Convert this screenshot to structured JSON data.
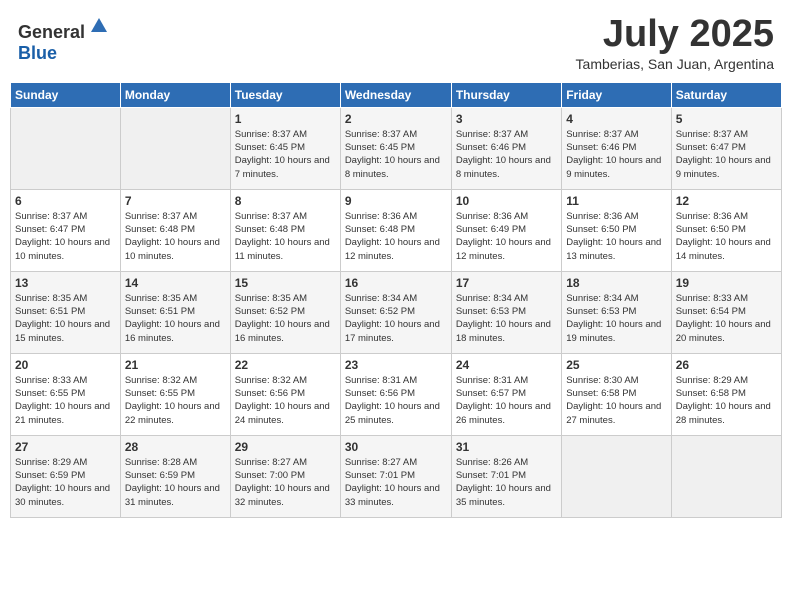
{
  "header": {
    "logo_general": "General",
    "logo_blue": "Blue",
    "month_title": "July 2025",
    "subtitle": "Tamberias, San Juan, Argentina"
  },
  "days_of_week": [
    "Sunday",
    "Monday",
    "Tuesday",
    "Wednesday",
    "Thursday",
    "Friday",
    "Saturday"
  ],
  "weeks": [
    [
      {
        "day": "",
        "sunrise": "",
        "sunset": "",
        "daylight": ""
      },
      {
        "day": "",
        "sunrise": "",
        "sunset": "",
        "daylight": ""
      },
      {
        "day": "1",
        "sunrise": "Sunrise: 8:37 AM",
        "sunset": "Sunset: 6:45 PM",
        "daylight": "Daylight: 10 hours and 7 minutes."
      },
      {
        "day": "2",
        "sunrise": "Sunrise: 8:37 AM",
        "sunset": "Sunset: 6:45 PM",
        "daylight": "Daylight: 10 hours and 8 minutes."
      },
      {
        "day": "3",
        "sunrise": "Sunrise: 8:37 AM",
        "sunset": "Sunset: 6:46 PM",
        "daylight": "Daylight: 10 hours and 8 minutes."
      },
      {
        "day": "4",
        "sunrise": "Sunrise: 8:37 AM",
        "sunset": "Sunset: 6:46 PM",
        "daylight": "Daylight: 10 hours and 9 minutes."
      },
      {
        "day": "5",
        "sunrise": "Sunrise: 8:37 AM",
        "sunset": "Sunset: 6:47 PM",
        "daylight": "Daylight: 10 hours and 9 minutes."
      }
    ],
    [
      {
        "day": "6",
        "sunrise": "Sunrise: 8:37 AM",
        "sunset": "Sunset: 6:47 PM",
        "daylight": "Daylight: 10 hours and 10 minutes."
      },
      {
        "day": "7",
        "sunrise": "Sunrise: 8:37 AM",
        "sunset": "Sunset: 6:48 PM",
        "daylight": "Daylight: 10 hours and 10 minutes."
      },
      {
        "day": "8",
        "sunrise": "Sunrise: 8:37 AM",
        "sunset": "Sunset: 6:48 PM",
        "daylight": "Daylight: 10 hours and 11 minutes."
      },
      {
        "day": "9",
        "sunrise": "Sunrise: 8:36 AM",
        "sunset": "Sunset: 6:48 PM",
        "daylight": "Daylight: 10 hours and 12 minutes."
      },
      {
        "day": "10",
        "sunrise": "Sunrise: 8:36 AM",
        "sunset": "Sunset: 6:49 PM",
        "daylight": "Daylight: 10 hours and 12 minutes."
      },
      {
        "day": "11",
        "sunrise": "Sunrise: 8:36 AM",
        "sunset": "Sunset: 6:50 PM",
        "daylight": "Daylight: 10 hours and 13 minutes."
      },
      {
        "day": "12",
        "sunrise": "Sunrise: 8:36 AM",
        "sunset": "Sunset: 6:50 PM",
        "daylight": "Daylight: 10 hours and 14 minutes."
      }
    ],
    [
      {
        "day": "13",
        "sunrise": "Sunrise: 8:35 AM",
        "sunset": "Sunset: 6:51 PM",
        "daylight": "Daylight: 10 hours and 15 minutes."
      },
      {
        "day": "14",
        "sunrise": "Sunrise: 8:35 AM",
        "sunset": "Sunset: 6:51 PM",
        "daylight": "Daylight: 10 hours and 16 minutes."
      },
      {
        "day": "15",
        "sunrise": "Sunrise: 8:35 AM",
        "sunset": "Sunset: 6:52 PM",
        "daylight": "Daylight: 10 hours and 16 minutes."
      },
      {
        "day": "16",
        "sunrise": "Sunrise: 8:34 AM",
        "sunset": "Sunset: 6:52 PM",
        "daylight": "Daylight: 10 hours and 17 minutes."
      },
      {
        "day": "17",
        "sunrise": "Sunrise: 8:34 AM",
        "sunset": "Sunset: 6:53 PM",
        "daylight": "Daylight: 10 hours and 18 minutes."
      },
      {
        "day": "18",
        "sunrise": "Sunrise: 8:34 AM",
        "sunset": "Sunset: 6:53 PM",
        "daylight": "Daylight: 10 hours and 19 minutes."
      },
      {
        "day": "19",
        "sunrise": "Sunrise: 8:33 AM",
        "sunset": "Sunset: 6:54 PM",
        "daylight": "Daylight: 10 hours and 20 minutes."
      }
    ],
    [
      {
        "day": "20",
        "sunrise": "Sunrise: 8:33 AM",
        "sunset": "Sunset: 6:55 PM",
        "daylight": "Daylight: 10 hours and 21 minutes."
      },
      {
        "day": "21",
        "sunrise": "Sunrise: 8:32 AM",
        "sunset": "Sunset: 6:55 PM",
        "daylight": "Daylight: 10 hours and 22 minutes."
      },
      {
        "day": "22",
        "sunrise": "Sunrise: 8:32 AM",
        "sunset": "Sunset: 6:56 PM",
        "daylight": "Daylight: 10 hours and 24 minutes."
      },
      {
        "day": "23",
        "sunrise": "Sunrise: 8:31 AM",
        "sunset": "Sunset: 6:56 PM",
        "daylight": "Daylight: 10 hours and 25 minutes."
      },
      {
        "day": "24",
        "sunrise": "Sunrise: 8:31 AM",
        "sunset": "Sunset: 6:57 PM",
        "daylight": "Daylight: 10 hours and 26 minutes."
      },
      {
        "day": "25",
        "sunrise": "Sunrise: 8:30 AM",
        "sunset": "Sunset: 6:58 PM",
        "daylight": "Daylight: 10 hours and 27 minutes."
      },
      {
        "day": "26",
        "sunrise": "Sunrise: 8:29 AM",
        "sunset": "Sunset: 6:58 PM",
        "daylight": "Daylight: 10 hours and 28 minutes."
      }
    ],
    [
      {
        "day": "27",
        "sunrise": "Sunrise: 8:29 AM",
        "sunset": "Sunset: 6:59 PM",
        "daylight": "Daylight: 10 hours and 30 minutes."
      },
      {
        "day": "28",
        "sunrise": "Sunrise: 8:28 AM",
        "sunset": "Sunset: 6:59 PM",
        "daylight": "Daylight: 10 hours and 31 minutes."
      },
      {
        "day": "29",
        "sunrise": "Sunrise: 8:27 AM",
        "sunset": "Sunset: 7:00 PM",
        "daylight": "Daylight: 10 hours and 32 minutes."
      },
      {
        "day": "30",
        "sunrise": "Sunrise: 8:27 AM",
        "sunset": "Sunset: 7:01 PM",
        "daylight": "Daylight: 10 hours and 33 minutes."
      },
      {
        "day": "31",
        "sunrise": "Sunrise: 8:26 AM",
        "sunset": "Sunset: 7:01 PM",
        "daylight": "Daylight: 10 hours and 35 minutes."
      },
      {
        "day": "",
        "sunrise": "",
        "sunset": "",
        "daylight": ""
      },
      {
        "day": "",
        "sunrise": "",
        "sunset": "",
        "daylight": ""
      }
    ]
  ]
}
